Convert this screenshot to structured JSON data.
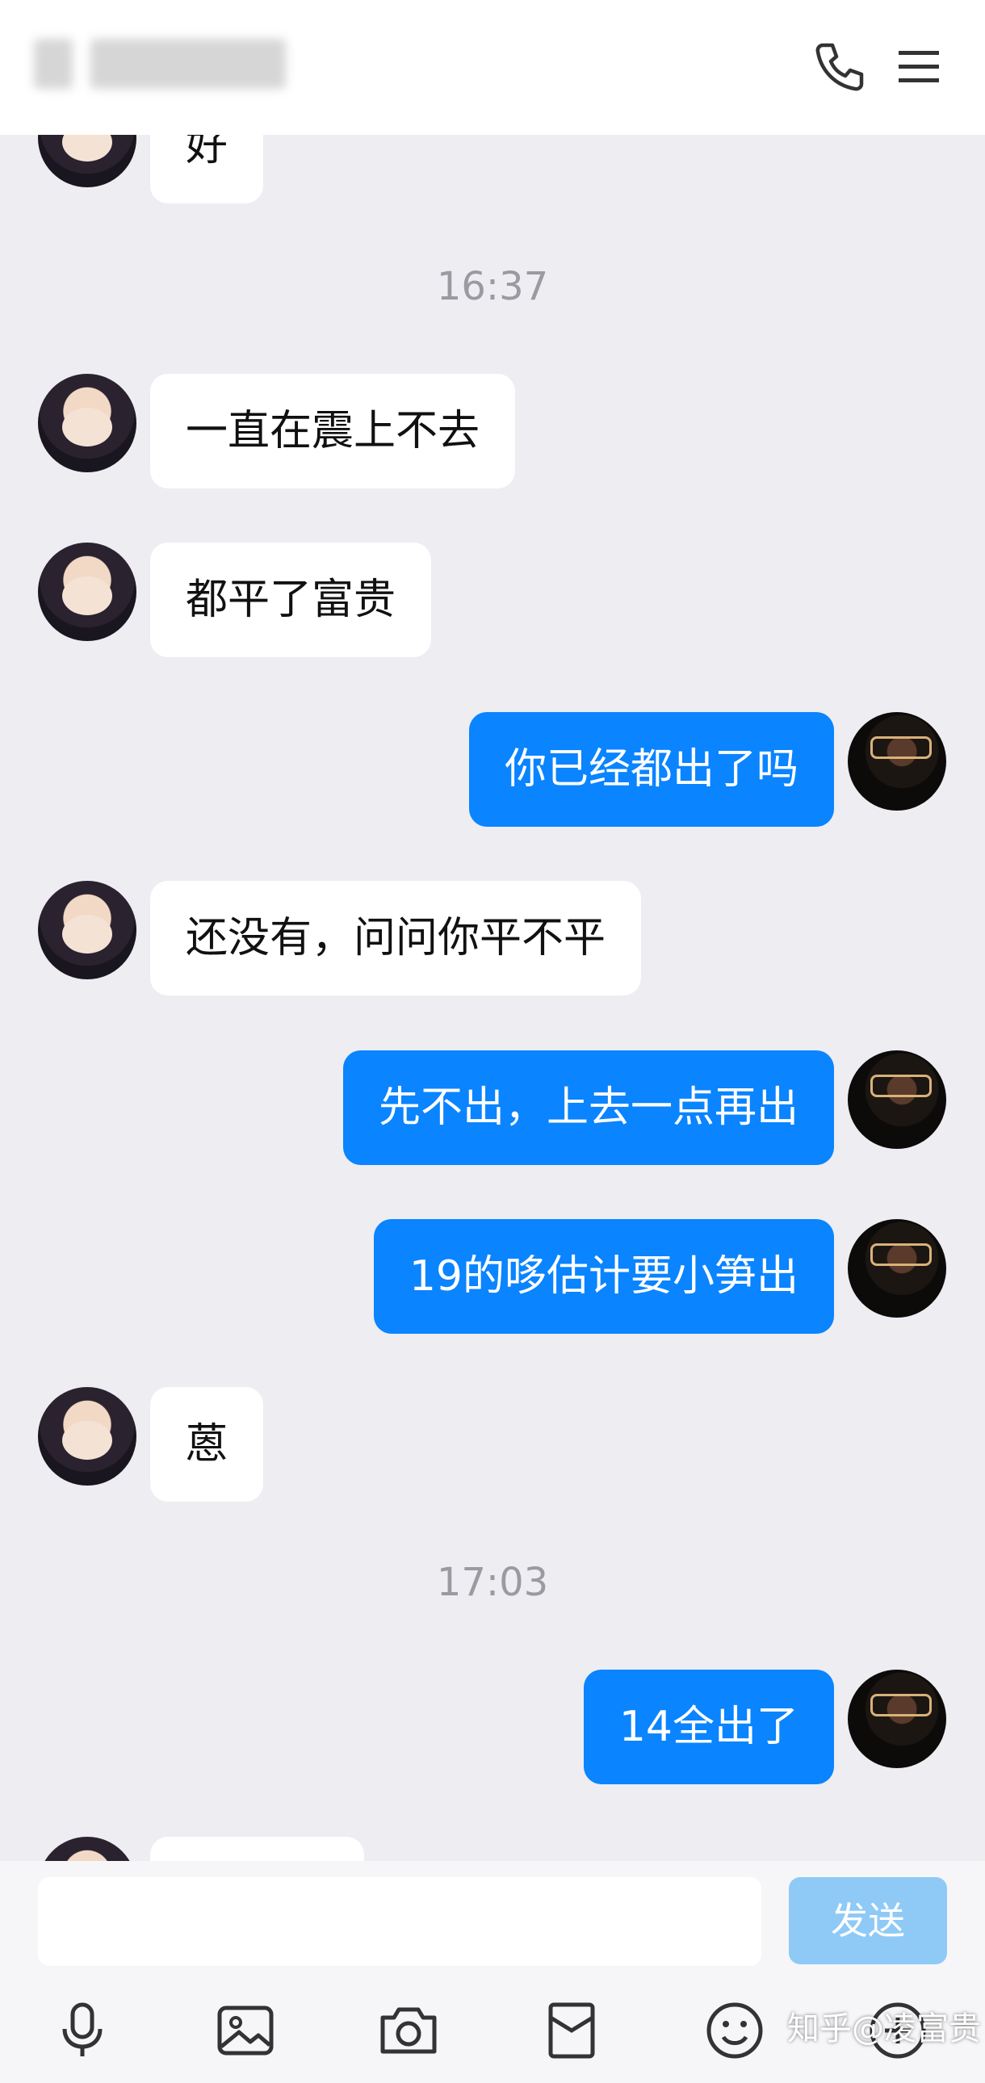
{
  "header": {
    "contact_name": "",
    "icons": [
      "phone-icon",
      "menu-icon"
    ]
  },
  "messages": [
    {
      "side": "in",
      "text": "好"
    },
    {
      "type": "time",
      "text": "16:37"
    },
    {
      "side": "in",
      "text": "一直在震上不去"
    },
    {
      "side": "in",
      "text": "都平了富贵"
    },
    {
      "side": "out",
      "text": "你已经都出了吗"
    },
    {
      "side": "in",
      "text": "还没有，问问你平不平"
    },
    {
      "side": "out",
      "text": "先不出，上去一点再出"
    },
    {
      "side": "out",
      "text": "19的哆估计要小笋出"
    },
    {
      "side": "in",
      "text": "蒽"
    },
    {
      "type": "time",
      "text": "17:03"
    },
    {
      "side": "out",
      "text": "14全出了"
    }
  ],
  "composer": {
    "input_value": "",
    "send_label": "发送",
    "toolbar_icons": [
      "microphone-icon",
      "image-icon",
      "camera-icon",
      "red-packet-icon",
      "emoji-icon",
      "plus-icon"
    ]
  },
  "watermark": "知乎@凌富贵",
  "colors": {
    "outgoing_bubble": "#0a84ff",
    "incoming_bubble": "#ffffff",
    "background": "#ededf2",
    "send_button": "#8fcaf6"
  }
}
